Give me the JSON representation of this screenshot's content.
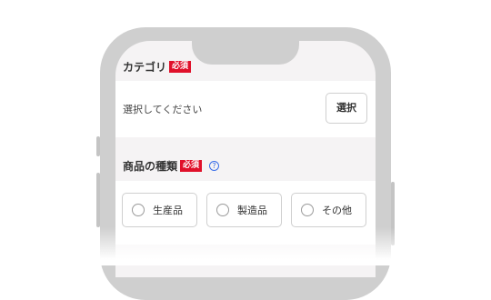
{
  "colors": {
    "frame": "#cfcfcf",
    "screen_bg": "#f5f3f4",
    "badge": "#e0102a",
    "help_icon": "#3a6ee8"
  },
  "category_section": {
    "title": "カテゴリ",
    "required_badge": "必須",
    "placeholder": "選択してください",
    "select_button": "選択"
  },
  "product_type_section": {
    "title": "商品の種類",
    "required_badge": "必須",
    "help_icon": "?",
    "options": [
      {
        "label": "生産品"
      },
      {
        "label": "製造品"
      },
      {
        "label": "その他"
      }
    ]
  }
}
